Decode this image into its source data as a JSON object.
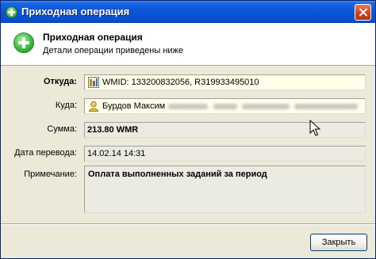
{
  "window": {
    "title": "Приходная операция"
  },
  "header": {
    "title": "Приходная операция",
    "subtitle": "Детали операции приведены ниже"
  },
  "details": {
    "from": {
      "label": "Откуда:",
      "value": "WMID: 133200832056, R319933495010"
    },
    "to": {
      "label": "Куда:",
      "value": "Бурдов Максим"
    },
    "amount": {
      "label": "Сумма:",
      "value": "213.80 WMR"
    },
    "date": {
      "label": "Дата перевода:",
      "value": "14.02.14 14:31"
    },
    "note": {
      "label": "Примечание:",
      "value": "Оплата выполненных заданий за период"
    }
  },
  "buttons": {
    "close_label": "Закрыть"
  },
  "icons": {
    "title": "plus-circle-icon",
    "header": "plus-circle-icon",
    "from": "webmoney-wmid-icon",
    "to": "person-icon",
    "close": "close-icon",
    "cursor": "mouse-pointer-icon"
  },
  "colors": {
    "titlebar": "#0b56d8",
    "window_bg": "#ece9d8",
    "field_highlight": "#fffee8",
    "accent_green": "#3cb43c"
  }
}
